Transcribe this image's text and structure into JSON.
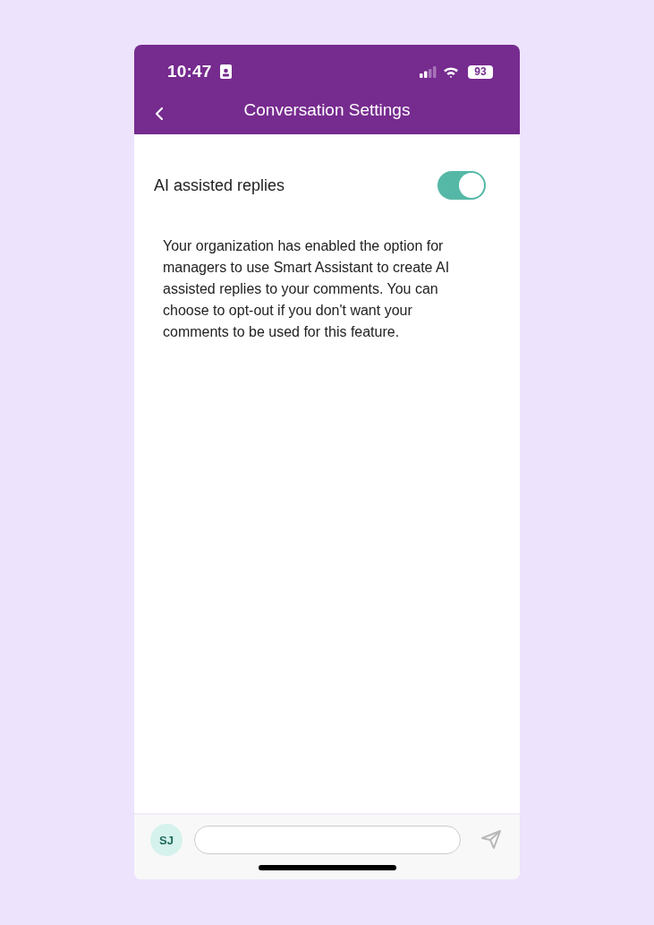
{
  "status_bar": {
    "time": "10:47",
    "battery": "93"
  },
  "header": {
    "title": "Conversation Settings"
  },
  "setting": {
    "label": "AI assisted replies",
    "on": true
  },
  "description": "Your organization has enabled the option for managers to use Smart Assistant to create AI assisted replies to your comments. You can choose to opt-out if you don't want your comments to be used for this feature.",
  "composer": {
    "avatar": "SJ"
  }
}
